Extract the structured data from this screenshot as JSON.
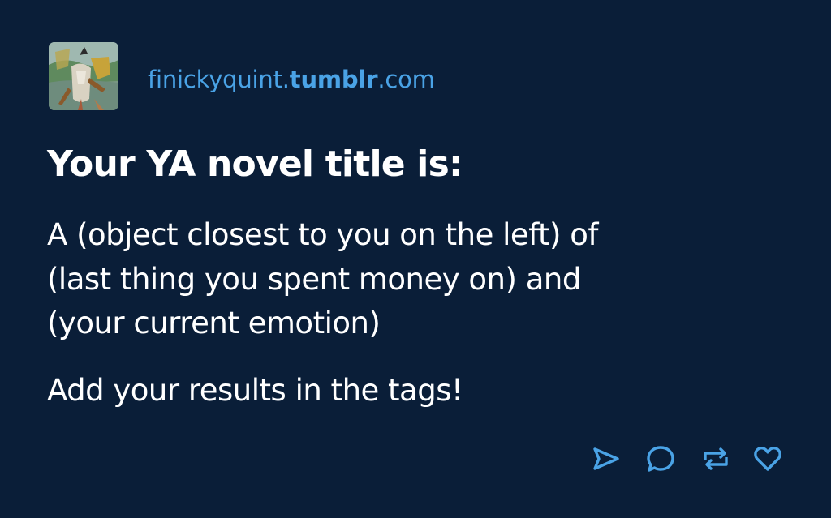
{
  "post": {
    "blog": {
      "name_prefix": "finickyquint.",
      "name_brand": "tumblr",
      "name_suffix": ".com",
      "avatar_icon": "avatar-image"
    },
    "title": "Your YA novel title is:",
    "body_lines": [
      "A (object closest to you on the left) of",
      "(last thing you spent money on) and",
      "(your current emotion)"
    ],
    "call_to_action": "Add your results in the tags!",
    "actions": [
      {
        "name": "share",
        "icon": "send-icon"
      },
      {
        "name": "reply",
        "icon": "speech-bubble-icon"
      },
      {
        "name": "reblog",
        "icon": "reblog-icon"
      },
      {
        "name": "like",
        "icon": "heart-icon"
      }
    ]
  },
  "colors": {
    "background": "#0a1e38",
    "accent": "#4aa3e6",
    "text": "#ffffff"
  }
}
